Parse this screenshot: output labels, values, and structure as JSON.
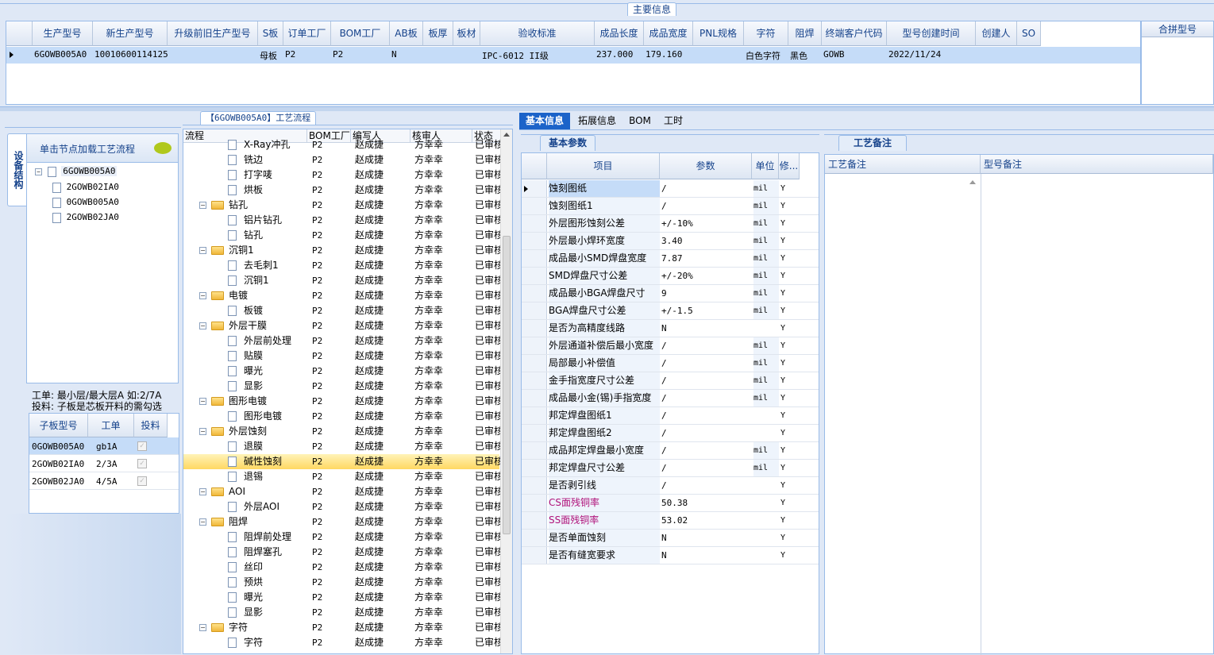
{
  "top": {
    "section_title": "主要信息",
    "headers": [
      "生产型号",
      "新生产型号",
      "升级前旧生产型号",
      "S板",
      "订单工厂",
      "BOM工厂",
      "AB板",
      "板厚",
      "板材",
      "验收标准",
      "成品长度",
      "成品宽度",
      "PNL规格",
      "字符",
      "阻焊",
      "终端客户代码",
      "型号创建时间",
      "创建人",
      "SO"
    ],
    "row": [
      "6GOWB005A0",
      "10010600114125",
      "",
      "母板",
      "P2",
      "P2",
      "N",
      "",
      "",
      "IPC-6012 II级",
      "237.000",
      "179.160",
      "",
      "白色字符",
      "黑色",
      "GOWB",
      "2022/11/24",
      "",
      ""
    ],
    "merge_label": "合拼型号"
  },
  "left": {
    "vertical_tab": "设备结构",
    "hint": "单击节点加载工艺流程",
    "tree_root": "6GOWB005A0",
    "tree_children": [
      "2GOWB02IA0",
      "0GOWB005A0",
      "2GOWB02JA0"
    ],
    "note_line1": "工单: 最小层/最大层A 如:2/7A",
    "note_line2": "投料: 子板是芯板开料的需勾选",
    "sub_headers": [
      "子板型号",
      "工单",
      "投料"
    ],
    "sub_rows": [
      [
        "0GOWB005A0",
        "gb1A"
      ],
      [
        "2GOWB02IA0",
        "2/3A"
      ],
      [
        "2GOWB02JA0",
        "4/5A"
      ]
    ]
  },
  "flow": {
    "title": "【6GOWB005A0】工艺流程",
    "headers": [
      "流程",
      "BOM工厂",
      "编写人",
      "核审人",
      "状态"
    ],
    "rows": [
      {
        "name": "X-Ray冲孔",
        "level": 2,
        "folder": false
      },
      {
        "name": "铣边",
        "level": 2,
        "folder": false
      },
      {
        "name": "打字唛",
        "level": 2,
        "folder": false
      },
      {
        "name": "烘板",
        "level": 2,
        "folder": false
      },
      {
        "name": "钻孔",
        "level": 1,
        "folder": true
      },
      {
        "name": "铝片钻孔",
        "level": 2,
        "folder": false
      },
      {
        "name": "钻孔",
        "level": 2,
        "folder": false
      },
      {
        "name": "沉铜1",
        "level": 1,
        "folder": true
      },
      {
        "name": "去毛刺1",
        "level": 2,
        "folder": false
      },
      {
        "name": "沉铜1",
        "level": 2,
        "folder": false
      },
      {
        "name": "电镀",
        "level": 1,
        "folder": true
      },
      {
        "name": "板镀",
        "level": 2,
        "folder": false
      },
      {
        "name": "外层干膜",
        "level": 1,
        "folder": true
      },
      {
        "name": "外层前处理",
        "level": 2,
        "folder": false
      },
      {
        "name": "贴膜",
        "level": 2,
        "folder": false
      },
      {
        "name": "曝光",
        "level": 2,
        "folder": false
      },
      {
        "name": "显影",
        "level": 2,
        "folder": false
      },
      {
        "name": "图形电镀",
        "level": 1,
        "folder": true
      },
      {
        "name": "图形电镀",
        "level": 2,
        "folder": false
      },
      {
        "name": "外层蚀刻",
        "level": 1,
        "folder": true
      },
      {
        "name": "退膜",
        "level": 2,
        "folder": false
      },
      {
        "name": "碱性蚀刻",
        "level": 2,
        "folder": false,
        "selected": true
      },
      {
        "name": "退锡",
        "level": 2,
        "folder": false
      },
      {
        "name": "AOI",
        "level": 1,
        "folder": true
      },
      {
        "name": "外层AOI",
        "level": 2,
        "folder": false
      },
      {
        "name": "阻焊",
        "level": 1,
        "folder": true
      },
      {
        "name": "阻焊前处理",
        "level": 2,
        "folder": false
      },
      {
        "name": "阻焊塞孔",
        "level": 2,
        "folder": false
      },
      {
        "name": "丝印",
        "level": 2,
        "folder": false
      },
      {
        "name": "预烘",
        "level": 2,
        "folder": false
      },
      {
        "name": "曝光",
        "level": 2,
        "folder": false
      },
      {
        "name": "显影",
        "level": 2,
        "folder": false
      },
      {
        "name": "字符",
        "level": 1,
        "folder": true
      },
      {
        "name": "字符",
        "level": 2,
        "folder": false
      }
    ],
    "bom": "P2",
    "writer": "赵成捷",
    "reviewer": "方幸幸",
    "status": "已审核"
  },
  "tabs": [
    "基本信息",
    "拓展信息",
    "BOM",
    "工时"
  ],
  "params": {
    "group_tab": "基本参数",
    "headers": [
      "项目",
      "参数",
      "单位",
      "修..."
    ],
    "rows": [
      [
        "蚀刻图纸",
        "/",
        "mil",
        "Y"
      ],
      [
        "蚀刻图纸1",
        "/",
        "mil",
        "Y"
      ],
      [
        "外层图形蚀刻公差",
        "+/-10%",
        "mil",
        "Y"
      ],
      [
        "外层最小焊环宽度",
        "3.40",
        "mil",
        "Y"
      ],
      [
        "成品最小SMD焊盘宽度",
        "7.87",
        "mil",
        "Y"
      ],
      [
        "SMD焊盘尺寸公差",
        "+/-20%",
        "mil",
        "Y"
      ],
      [
        "成品最小BGA焊盘尺寸",
        "9",
        "mil",
        "Y"
      ],
      [
        "BGA焊盘尺寸公差",
        "+/-1.5",
        "mil",
        "Y"
      ],
      [
        "是否为高精度线路",
        "N",
        "",
        "Y"
      ],
      [
        "外层通道补偿后最小宽度",
        "/",
        "mil",
        "Y"
      ],
      [
        "局部最小补偿值",
        "/",
        "mil",
        "Y"
      ],
      [
        "金手指宽度尺寸公差",
        "/",
        "mil",
        "Y"
      ],
      [
        "成品最小金(锡)手指宽度",
        "/",
        "mil",
        "Y"
      ],
      [
        "邦定焊盘图纸1",
        "/",
        "",
        "Y"
      ],
      [
        "邦定焊盘图纸2",
        "/",
        "",
        "Y"
      ],
      [
        "成品邦定焊盘最小宽度",
        "/",
        "mil",
        "Y"
      ],
      [
        "邦定焊盘尺寸公差",
        "/",
        "mil",
        "Y"
      ],
      [
        "是否剥引线",
        "/",
        "",
        "Y"
      ],
      [
        "CS面残铜率",
        "50.38",
        "",
        "Y"
      ],
      [
        "SS面残铜率",
        "53.02",
        "",
        "Y"
      ],
      [
        "是否单面蚀刻",
        "N",
        "",
        "Y"
      ],
      [
        "是否有缝宽要求",
        "N",
        "",
        "Y"
      ]
    ],
    "pink_rows": [
      18,
      19
    ]
  },
  "remarks": {
    "group_tab": "工艺备注",
    "col1": "工艺备注",
    "col2": "型号备注"
  }
}
